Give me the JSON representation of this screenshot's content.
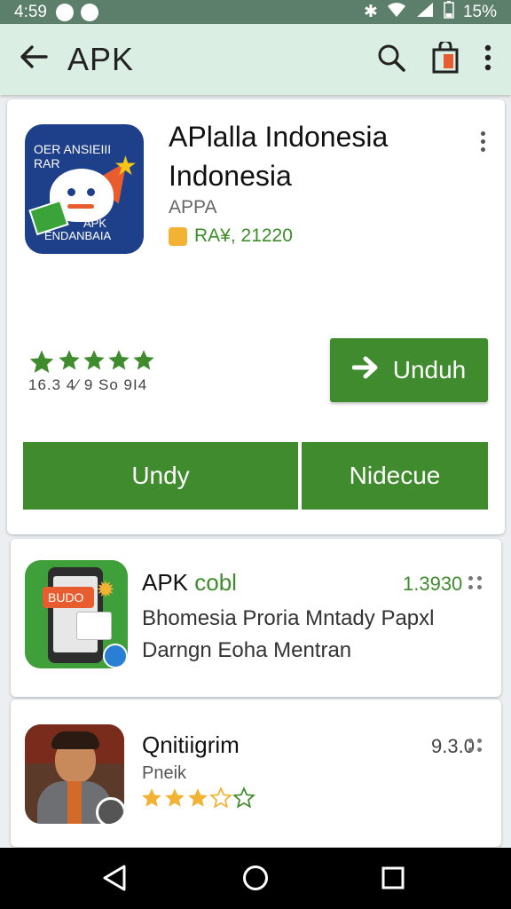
{
  "status_bar": {
    "time": "4:59",
    "battery": "15%"
  },
  "app_bar": {
    "title": "APK"
  },
  "featured": {
    "name": "APlalla Indonesia Indonesia",
    "developer": "APPA",
    "meta": "RA¥, 21220",
    "icon_text": {
      "line1": "OER ANSIEIII",
      "line2": "RAR",
      "line3": "APK",
      "line4": "ENDANBAIA"
    },
    "rating_text": "16.3 4⁄ 9 So 9I4",
    "install_label": "Unduh",
    "button_left": "Undy",
    "button_right": "Nidecue"
  },
  "list": [
    {
      "title_prefix": "APK",
      "title_suffix": "cobl",
      "line1": "Bhomesia Proria Mntady Papxl",
      "line2": "Darngn Eoha Mentran",
      "number": "1.3930",
      "icon_text": "BUDO"
    },
    {
      "title": "Qnitiigrim",
      "subtitle": "Pneik",
      "number": "9.3.0",
      "rating": 3
    }
  ],
  "colors": {
    "accent": "#3f8b2e",
    "status_bar": "#5b7f6a",
    "app_bar": "#dbeee3",
    "star_gold": "#f2b233"
  }
}
